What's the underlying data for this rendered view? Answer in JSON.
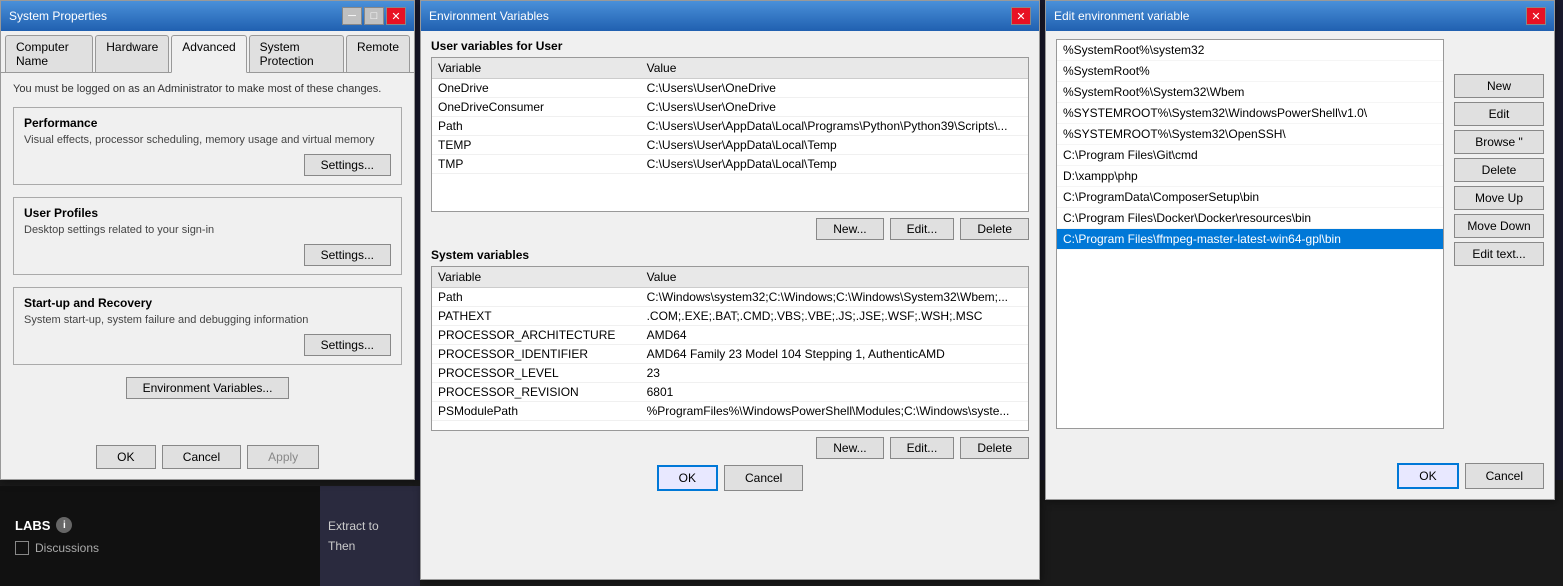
{
  "systemProps": {
    "title": "System Properties",
    "tabs": [
      "Computer Name",
      "Hardware",
      "Advanced",
      "System Protection",
      "Remote"
    ],
    "activeTab": "Advanced",
    "warning": "You must be logged on as an Administrator to make most of these changes.",
    "performance": {
      "title": "Performance",
      "desc": "Visual effects, processor scheduling, memory usage and virtual memory",
      "settingsLabel": "Settings..."
    },
    "userProfiles": {
      "title": "User Profiles",
      "desc": "Desktop settings related to your sign-in",
      "settingsLabel": "Settings..."
    },
    "startupRecovery": {
      "title": "Start-up and Recovery",
      "desc": "System start-up, system failure and debugging information",
      "settingsLabel": "Settings..."
    },
    "envVarsLabel": "Environment Variables...",
    "okLabel": "OK",
    "cancelLabel": "Cancel",
    "applyLabel": "Apply"
  },
  "envVars": {
    "title": "Environment Variables",
    "userVarsTitle": "User variables for User",
    "userVarsColumns": [
      "Variable",
      "Value"
    ],
    "userVarsRows": [
      {
        "variable": "OneDrive",
        "value": "C:\\Users\\User\\OneDrive"
      },
      {
        "variable": "OneDriveConsumer",
        "value": "C:\\Users\\User\\OneDrive"
      },
      {
        "variable": "Path",
        "value": "C:\\Users\\User\\AppData\\Local\\Programs\\Python\\Python39\\Scripts\\..."
      },
      {
        "variable": "TEMP",
        "value": "C:\\Users\\User\\AppData\\Local\\Temp"
      },
      {
        "variable": "TMP",
        "value": "C:\\Users\\User\\AppData\\Local\\Temp"
      }
    ],
    "sysVarsTitle": "System variables",
    "sysVarsColumns": [
      "Variable",
      "Value"
    ],
    "sysVarsRows": [
      {
        "variable": "Path",
        "value": "C:\\Windows\\system32;C:\\Windows;C:\\Windows\\System32\\Wbem;..."
      },
      {
        "variable": "PATHEXT",
        "value": ".COM;.EXE;.BAT;.CMD;.VBS;.VBE;.JS;.JSE;.WSF;.WSH;.MSC"
      },
      {
        "variable": "PROCESSOR_ARCHITECTURE",
        "value": "AMD64"
      },
      {
        "variable": "PROCESSOR_IDENTIFIER",
        "value": "AMD64 Family 23 Model 104 Stepping 1, AuthenticAMD"
      },
      {
        "variable": "PROCESSOR_LEVEL",
        "value": "23"
      },
      {
        "variable": "PROCESSOR_REVISION",
        "value": "6801"
      },
      {
        "variable": "PSModulePath",
        "value": "%ProgramFiles%\\WindowsPowerShell\\Modules;C:\\Windows\\syste..."
      }
    ],
    "newLabel": "New...",
    "editLabel": "Edit...",
    "deleteLabel": "Delete",
    "okLabel": "OK",
    "cancelLabel": "Cancel"
  },
  "editEnvVar": {
    "title": "Edit environment variable",
    "items": [
      "%SystemRoot%\\system32",
      "%SystemRoot%",
      "%SystemRoot%\\System32\\Wbem",
      "%SYSTEMROOT%\\System32\\WindowsPowerShell\\v1.0\\",
      "%SYSTEMROOT%\\System32\\OpenSSH\\",
      "C:\\Program Files\\Git\\cmd",
      "D:\\xampp\\php",
      "C:\\ProgramData\\ComposerSetup\\bin",
      "C:\\Program Files\\Docker\\Docker\\resources\\bin",
      "C:\\Program Files\\ffmpeg-master-latest-win64-gpl\\bin"
    ],
    "selectedItem": "C:\\Program Files\\ffmpeg-master-latest-win64-gpl\\bin",
    "buttons": {
      "newLabel": "New",
      "editLabel": "Edit",
      "browseLabel": "Browse \"",
      "deleteLabel": "Delete",
      "moveUpLabel": "Move Up",
      "moveDownLabel": "Move Down",
      "editTextLabel": "Edit text..."
    },
    "okLabel": "OK",
    "cancelLabel": "Cancel"
  },
  "bottomBar": {
    "extractText": "Extract to",
    "thenText": "Then",
    "labs": {
      "title": "LABS",
      "discussionsLabel": "Discussions"
    }
  }
}
